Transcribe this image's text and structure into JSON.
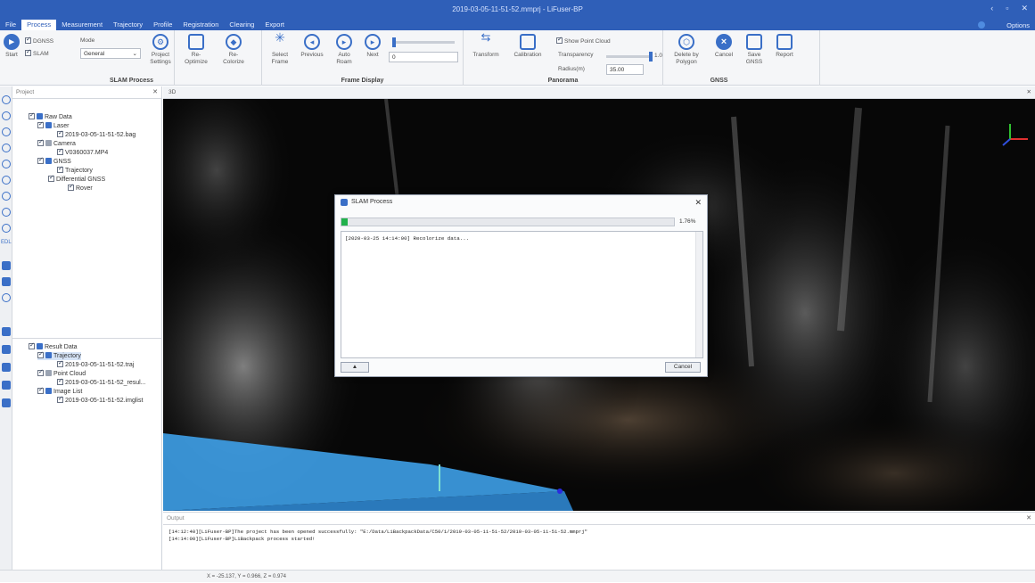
{
  "window": {
    "title": "2019-03-05-11-51-52.mmprj - LiFuser-BP",
    "controls": [
      "‹",
      "▫",
      "✕"
    ]
  },
  "menu": [
    "File",
    "Process",
    "Measurement",
    "Trajectory",
    "Profile",
    "Registration",
    "Clearing",
    "Export"
  ],
  "menu_active": "Process",
  "options_label": "Options",
  "ribbon": {
    "slam_process": {
      "label": "SLAM Process",
      "start": "Start",
      "dgnss": "DGNSS",
      "slam": "SLAM",
      "mode_label": "Mode",
      "mode_value": "General",
      "project_settings": "Project Settings",
      "re_optimize": "Re-Optimize",
      "re_colorize": "Re-Colorize"
    },
    "frame_display": {
      "label": "Frame Display",
      "select_frame": "Select Frame",
      "previous": "Previous",
      "auto_roam": "Auto Roam",
      "next": "Next",
      "frame_value": "0"
    },
    "panorama": {
      "label": "Panorama",
      "transform": "Transform",
      "calibration": "Calibration",
      "show_point_cloud": "Show Point Cloud",
      "transparency_label": "Transparency",
      "transparency_value": "1.0",
      "radius_label": "Radius(m)",
      "radius_value": "35.00"
    },
    "gnss": {
      "label": "GNSS",
      "delete_by_polygon": "Delete by Polygon",
      "cancel": "Cancel",
      "save_gnss": "Save GNSS",
      "report": "Report"
    }
  },
  "project_panel": {
    "title": "Project",
    "raw_data": {
      "label": "Raw Data",
      "laser": "Laser",
      "laser_file": "2019-03-05-11-51-52.bag",
      "camera": "Camera",
      "camera_file": "V0360037.MP4",
      "gnss": "GNSS",
      "trajectory": "Trajectory",
      "differential_gnss": "Differential GNSS",
      "rover": "Rover"
    },
    "result_data": {
      "label": "Result Data",
      "trajectory": "Trajectory",
      "trajectory_file": "2019-03-05-11-51-52.traj",
      "point_cloud": "Point Cloud",
      "point_cloud_file": "2019-03-05-11-51-52_resul...",
      "image_list": "Image List",
      "image_list_file": "2019-03-05-11-51-52.imglist"
    },
    "strip_label": "EDL"
  },
  "view_tab": "3D",
  "dialog": {
    "title": "SLAM Process",
    "progress_percent": 1.76,
    "progress_text": "1.76%",
    "log_line": "[2020-03-25 14:14:00] Recolorize data...",
    "expand_button": "▲",
    "cancel_button": "Cancel"
  },
  "output": {
    "title": "Output",
    "lines": [
      "[14:12:40][LiFuser-BP]The project has been opened successfully: \"E:/Data/LiBackpackData/C50/1/2019-03-05-11-51-52/2019-03-05-11-51-52.mmprj\"",
      "[14:14:00][LiFuser-BP]LiBackpack process started!"
    ]
  },
  "status": "X = -25.137, Y = 0.966, Z = 0.974"
}
